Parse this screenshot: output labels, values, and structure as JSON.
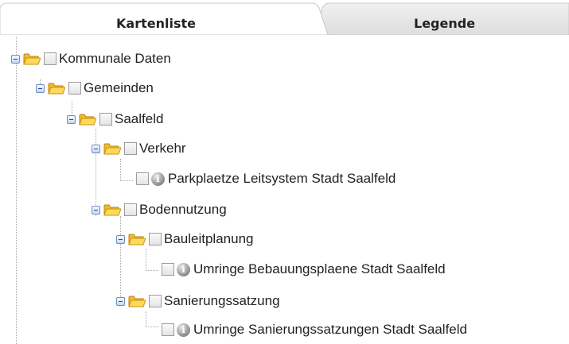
{
  "tabs": [
    {
      "label": "Kartenliste",
      "active": true
    },
    {
      "label": "Legende",
      "active": false
    }
  ],
  "icons": {
    "toggle": "collapse-minus-icon",
    "folder": "open-folder-icon",
    "info": "info-icon"
  },
  "tree": [
    {
      "label": "Kommunale Daten",
      "type": "folder"
    },
    {
      "label": "Gemeinden",
      "type": "folder"
    },
    {
      "label": "Saalfeld",
      "type": "folder"
    },
    {
      "label": "Verkehr",
      "type": "folder"
    },
    {
      "label": "Parkplaetze Leitsystem Stadt Saalfeld",
      "type": "layer"
    },
    {
      "label": "Bodennutzung",
      "type": "folder"
    },
    {
      "label": "Bauleitplanung",
      "type": "folder"
    },
    {
      "label": "Umringe Bebauungsplaene Stadt Saalfeld",
      "type": "layer"
    },
    {
      "label": "Sanierungssatzung",
      "type": "folder"
    },
    {
      "label": "Umringe Sanierungssatzungen Stadt Saalfeld",
      "type": "layer"
    }
  ],
  "colors": {
    "tab_active": "#ffffff",
    "tab_inactive": "#e3e3e3",
    "folder": "#f4c430",
    "toggle_border": "#6c8dc4"
  }
}
